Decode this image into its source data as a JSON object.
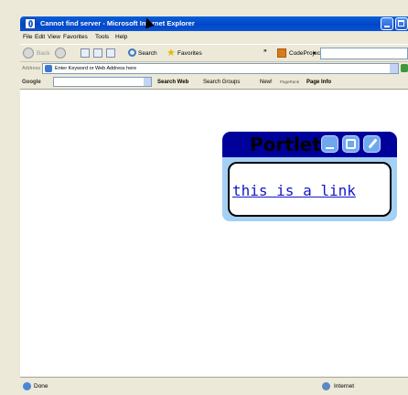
{
  "window": {
    "title": "Cannot find server - Microsoft Internet Explorer"
  },
  "menubar": {
    "items": [
      "File",
      "Edit",
      "View",
      "Favorites",
      "Tools",
      "Help"
    ]
  },
  "toolbar": {
    "back_label": "Back",
    "search_label": "Search",
    "favorites_label": "Favorites",
    "codeproject_label": "CodeProject"
  },
  "addressbar": {
    "label": "Address",
    "value": "Enter Keyword or Web Address here"
  },
  "googlebar": {
    "logo": "Google",
    "search_web": "Search Web",
    "search_groups": "Search Groups",
    "new_label": "New!",
    "pagerank_label": "PageRank",
    "page_info": "Page Info"
  },
  "portlet": {
    "title": "Portlet",
    "link_text": "this is a link"
  },
  "statusbar": {
    "status": "Done",
    "zone": "Internet"
  }
}
